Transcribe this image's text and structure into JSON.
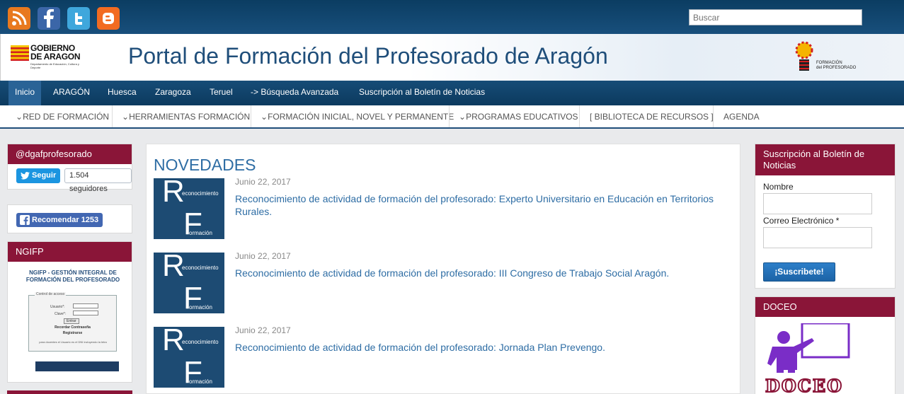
{
  "topbar": {
    "social_icons": [
      "rss-icon",
      "facebook-icon",
      "twitter-icon",
      "blogger-icon"
    ],
    "search_placeholder": "Buscar"
  },
  "banner": {
    "title": "Portal de Formación del Profesorado de Aragón",
    "left_logo": {
      "line1": "GOBIERNO",
      "line2": "DE ARAGON",
      "sub": "Departamento de Educación, Cultura y Deporte"
    },
    "right_logo": {
      "line1": "FORMACIÓN",
      "line2": "del PROFESORADO"
    }
  },
  "nav_primary": [
    "Inicio",
    "ARAGÓN",
    "Huesca",
    "Zaragoza",
    "Teruel",
    "-> Búsqueda Avanzada",
    "Suscripción al Boletín de Noticias"
  ],
  "nav_secondary": [
    "RED DE FORMACIÓN",
    "HERRAMIENTAS FORMACIÓN",
    "FORMACIÓN INICIAL, NOVEL Y PERMANENTE",
    "PROGRAMAS EDUCATIVOS",
    "[ BIBLIOTECA DE RECURSOS ]",
    "AGENDA"
  ],
  "left_sidebar": {
    "twitter": {
      "title": "@dgafprofesorado",
      "follow_label": "Seguir",
      "followers": "1.504 seguidores"
    },
    "facebook": {
      "recommend_label": "Recomendar 1253"
    },
    "ngifp": {
      "title": "NGIFP",
      "image_title": "NGIFP - GESTIÓN INTEGRAL DE FORMACIÓN DEL PROFESORADO",
      "box_legend": "Control de acceso",
      "user_label": "Usuario*:",
      "pass_label": "Clave*:",
      "enter_label": "Entrar",
      "recover_label": "Recordar Contraseña",
      "register_label": "Registrarse",
      "note": "para docentes el Usuario es el DNI incluyendo la letra"
    }
  },
  "main": {
    "section_title": "NOVEDADES",
    "posts": [
      {
        "date": "Junio 22, 2017",
        "title": "Reconocimiento de actividad de formación del profesorado: Experto Universitario en Educación en Territorios Rurales.",
        "thumb": {
          "big1": "R",
          "small1": "econocimiento",
          "big2": "F",
          "small2": "ormación"
        }
      },
      {
        "date": "Junio 22, 2017",
        "title": "Reconocimiento de actividad de formación del profesorado: III Congreso de Trabajo Social Aragón.",
        "thumb": {
          "big1": "R",
          "small1": "econocimiento",
          "big2": "F",
          "small2": "ormación"
        }
      },
      {
        "date": "Junio 22, 2017",
        "title": "Reconocimiento de actividad de formación del profesorado: Jornada Plan Prevengo.",
        "thumb": {
          "big1": "R",
          "small1": "econocimiento",
          "big2": "F",
          "small2": "ormación"
        }
      }
    ]
  },
  "right_sidebar": {
    "newsletter": {
      "title": "Suscripción al Boletín de Noticias",
      "name_label": "Nombre",
      "email_label": "Correo Electrónico *",
      "submit_label": "¡Suscribete!"
    },
    "doceo": {
      "title": "DOCEO",
      "image_text": "DOCEO"
    }
  },
  "colors": {
    "nav_blue": "#0c3a5e",
    "accent_maroon": "#8a1538",
    "link_blue": "#2e6da4"
  }
}
